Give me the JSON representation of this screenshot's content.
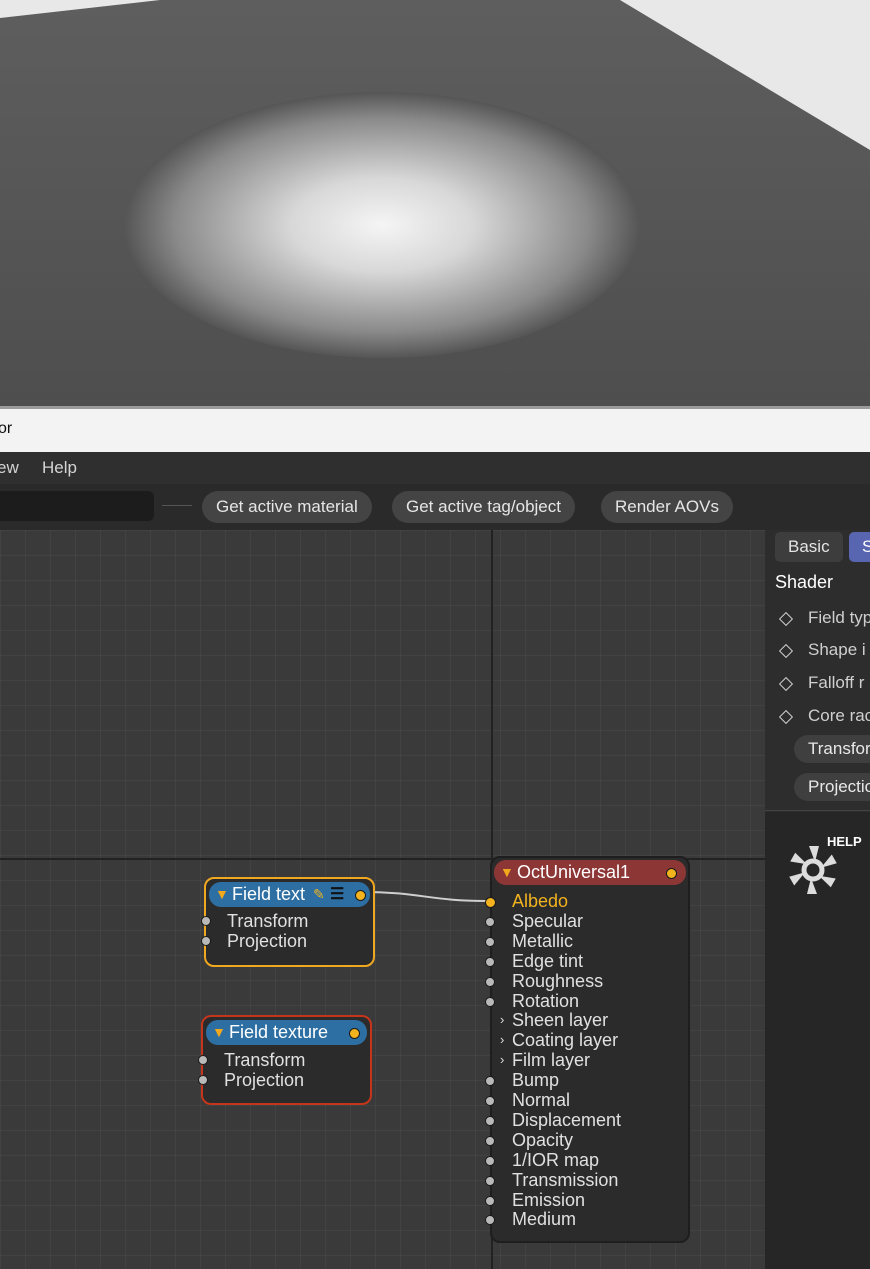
{
  "window": {
    "title_fragment": "or"
  },
  "menu": {
    "items": [
      "ew",
      "Help"
    ]
  },
  "toolbar": {
    "search_value": "",
    "buttons": [
      "Get active material",
      "Get active tag/object",
      "Render AOVs"
    ]
  },
  "nodes": {
    "field_text": {
      "title": "Field text",
      "inputs": [
        "Transform",
        "Projection"
      ]
    },
    "field_texture": {
      "title": "Field texture",
      "inputs": [
        "Transform",
        "Projection"
      ]
    },
    "material": {
      "title": "OctUniversal1",
      "pins": [
        "Albedo",
        "Specular",
        "Metallic",
        "Edge tint",
        "Roughness",
        "Rotation",
        "Sheen layer",
        "Coating layer",
        "Film layer",
        "Bump",
        "Normal",
        "Displacement",
        "Opacity",
        "1/IOR map",
        "Transmission",
        "Emission",
        "Medium"
      ]
    }
  },
  "panel": {
    "tabs": [
      "Basic",
      "S"
    ],
    "heading": "Shader",
    "params": [
      "Field typ",
      "Shape i",
      "Falloff r",
      "Core rac"
    ],
    "groups": [
      "Transfor",
      "Projectio"
    ],
    "help_label": "HELP"
  },
  "colors": {
    "accent_orange": "#f2b31f",
    "node_header_blue": "#2e6fa3",
    "material_header_red": "#8c3636",
    "selected_outline": "#f0a820",
    "error_outline": "#c4351c",
    "active_tab": "#5865b0"
  }
}
